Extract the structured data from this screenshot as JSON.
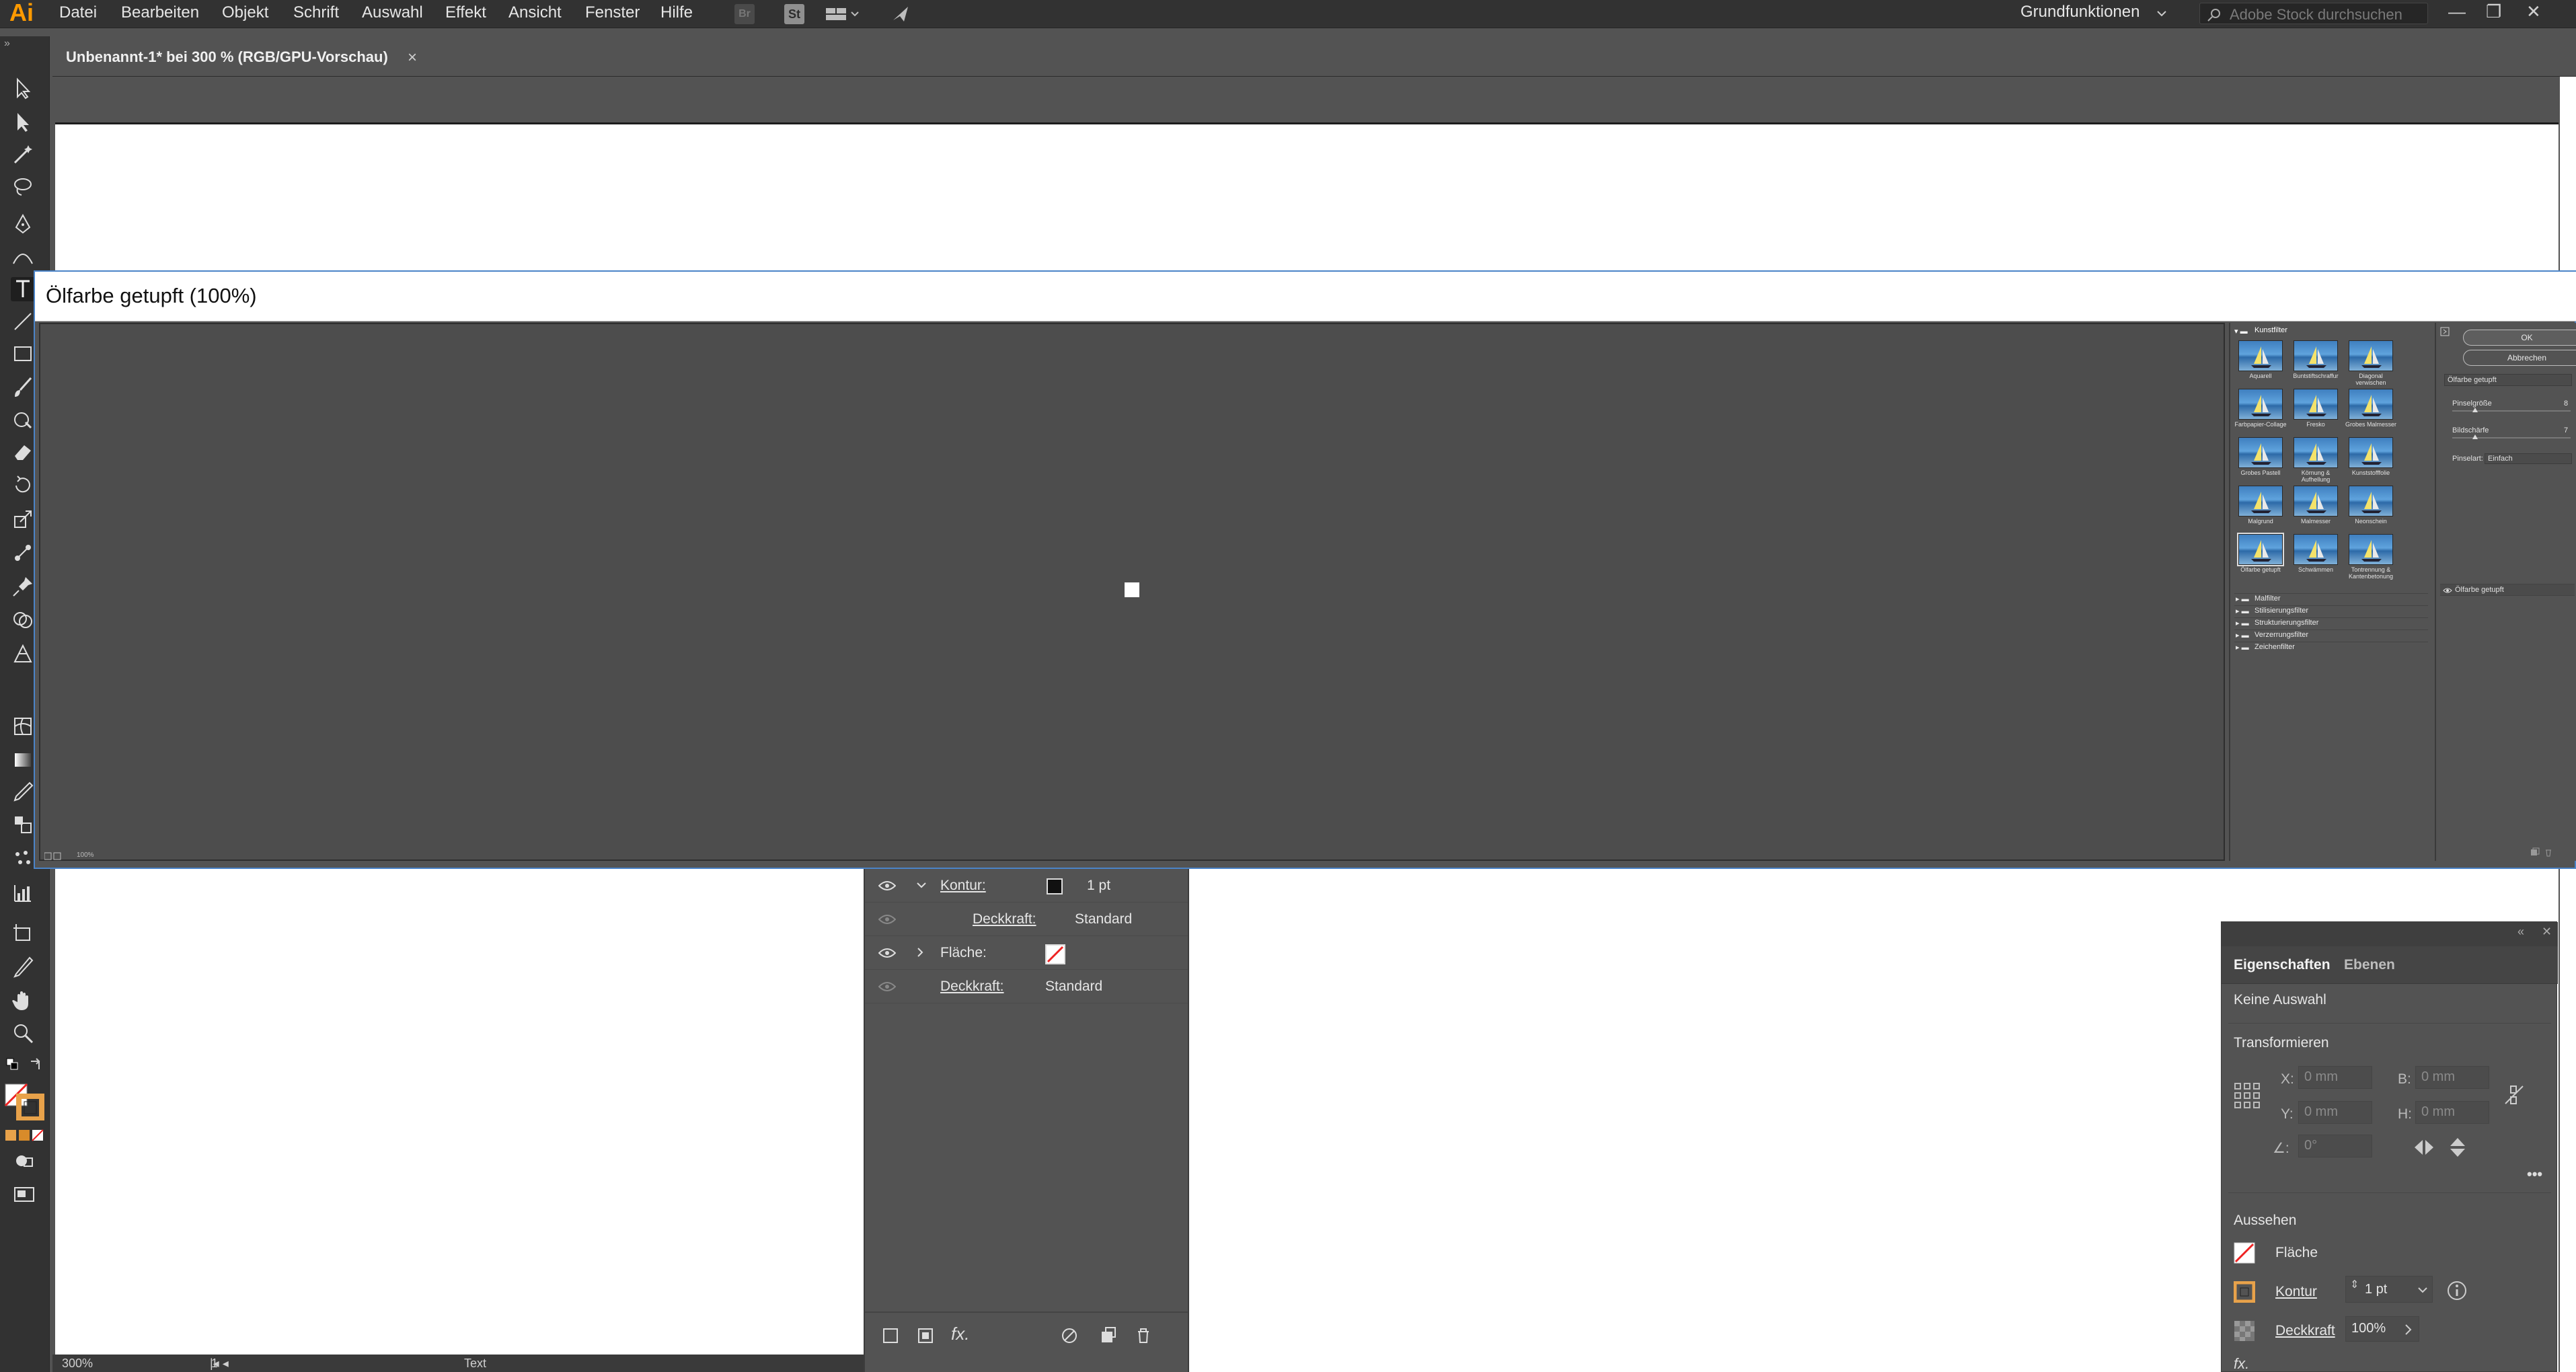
{
  "app": {
    "logo": "Ai"
  },
  "menu": [
    "Datei",
    "Bearbeiten",
    "Objekt",
    "Schrift",
    "Auswahl",
    "Effekt",
    "Ansicht",
    "Fenster",
    "Hilfe"
  ],
  "toolbar_icons": {
    "br": "Br",
    "st": "St"
  },
  "workspace": {
    "label": "Grundfunktionen"
  },
  "search": {
    "placeholder": "Adobe Stock durchsuchen"
  },
  "document_tab": {
    "title": "Unbenannt-1* bei 300 % (RGB/GPU-Vorschau)",
    "close": "×"
  },
  "dialog": {
    "title": "Ölfarbe getupft (100%)",
    "preview_zoom": "100%",
    "gallery": {
      "open_category": "Kunstfilter",
      "filters": [
        "Aquarell",
        "Buntstiftschraffur",
        "Diagonal verwischen",
        "Farbpapier-Collage",
        "Fresko",
        "Grobes Malmesser",
        "Grobes Pastell",
        "Körnung & Aufhellung",
        "Kunststofffolie",
        "Malgrund",
        "Malmesser",
        "Neonschein",
        "Ölfarbe getupft",
        "Schwämmen",
        "Tontrennung & Kantenbetonung"
      ],
      "categories": [
        "Malfilter",
        "Stilisierungsfilter",
        "Strukturierungsfilter",
        "Verzerrungsfilter",
        "Zeichenfilter"
      ]
    },
    "ok_label": "OK",
    "cancel_label": "Abbrechen",
    "selected_filter": "Ölfarbe getupft",
    "params": [
      {
        "label": "Pinselgröße",
        "value": "8"
      },
      {
        "label": "Bildschärfe",
        "value": "7"
      }
    ],
    "brush_type_label": "Pinselart:",
    "brush_type_value": "Einfach",
    "effect_layer": "Ölfarbe getupft"
  },
  "appearance": {
    "rows": [
      {
        "label": "Kontur:",
        "value": "1 pt"
      },
      {
        "label": "Deckkraft:",
        "value": "Standard"
      },
      {
        "label": "Fläche:",
        "value": ""
      },
      {
        "label": "Deckkraft:",
        "value": "Standard"
      }
    ],
    "fx": "fx."
  },
  "properties": {
    "tab_active": "Eigenschaften",
    "tab_inactive": "Ebenen",
    "no_selection": "Keine Auswahl",
    "transform_title": "Transformieren",
    "x_label": "X:",
    "x_value": "0 mm",
    "y_label": "Y:",
    "y_value": "0 mm",
    "w_label": "B:",
    "w_value": "0 mm",
    "h_label": "H:",
    "h_value": "0 mm",
    "angle_label": "∠:",
    "angle_value": "0°",
    "appearance_title": "Aussehen",
    "fill_label": "Fläche",
    "stroke_label": "Kontur",
    "stroke_value": "1 pt",
    "opacity_label": "Deckkraft",
    "opacity_value": "100%",
    "fx_label": "fx."
  },
  "status": {
    "zoom": "300%",
    "page": "1",
    "tool": "Text"
  }
}
